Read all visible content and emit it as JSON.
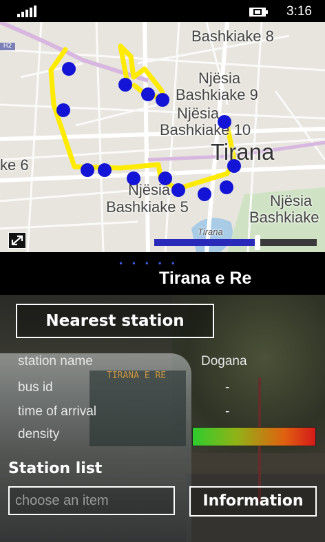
{
  "status_bar": {
    "time": "3:16",
    "signal_icon": "signal-bars-icon",
    "battery_icon": "battery-charging-icon"
  },
  "map": {
    "highway_label": "H2",
    "labels": {
      "bashkiake8": "Bashkiake 8",
      "njesia9_a": "Njësia",
      "njesia9_b": "Bashkiake 9",
      "njesia10_a": "Njësia",
      "njesia10_b": "Bashkiake 10",
      "city": "Tirana",
      "njesia6": "ke 6",
      "njesia5_a": "Njësia",
      "njesia5_b": "Bashkiake 5",
      "njesia_e_a": "Njësia",
      "njesia_e_b": "Bashkiake",
      "lake": "Tirana"
    },
    "route_color": "#ffeb00",
    "stop_color": "#1414d6",
    "zoom_level_fraction": 0.62,
    "expand_icon": "expand-icon"
  },
  "pivot": {
    "indicator": "• • • • •",
    "title": "Tirana e Re"
  },
  "photo_sign": "TIRANA E RE",
  "nearest_station_button": "Nearest station",
  "info": {
    "station_name_label": "station name",
    "station_name_value": "Dogana",
    "bus_id_label": "bus id",
    "bus_id_value": "-",
    "arrival_label": "time of arrival",
    "arrival_value": "-",
    "density_label": "density",
    "density_colors": [
      "#2ecc2e",
      "#d51a1a"
    ]
  },
  "station_list": {
    "title": "Station list",
    "placeholder": "choose an item"
  },
  "information_button": "Information"
}
